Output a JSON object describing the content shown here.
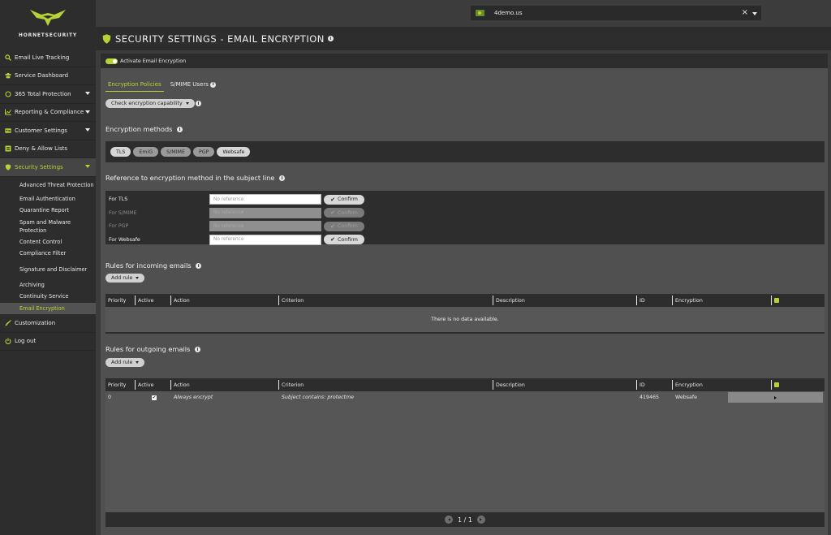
{
  "brand": {
    "name": "HORNETSECURITY",
    "accent": "#b4d337"
  },
  "tenant": {
    "name": "4demo.us"
  },
  "sidebar": {
    "items": [
      {
        "label": "Email Live Tracking",
        "icon": "search-icon"
      },
      {
        "label": "Service Dashboard",
        "icon": "users-icon"
      },
      {
        "label": "365 Total Protection",
        "icon": "circle-icon"
      },
      {
        "label": "Reporting & Compliance",
        "icon": "chart-icon"
      },
      {
        "label": "Customer Settings",
        "icon": "id-card-icon"
      },
      {
        "label": "Deny & Allow Lists",
        "icon": "list-icon"
      },
      {
        "label": "Security Settings",
        "icon": "shield-icon"
      }
    ],
    "security_sub": [
      "Advanced Threat Protection",
      "Email Authentication",
      "Quarantine Report",
      "Spam and Malware Protection",
      "Content Control",
      "Compliance Filter",
      "Signature and Disclaimer",
      "Archiving",
      "Continuity Service",
      "Email Encryption"
    ],
    "bottom": [
      {
        "label": "Customization",
        "icon": "brush-icon"
      },
      {
        "label": "Log out",
        "icon": "power-icon"
      }
    ]
  },
  "page": {
    "title": "SECURITY SETTINGS - EMAIL ENCRYPTION"
  },
  "activate_label": "Activate Email Encryption",
  "tabs": [
    "Encryption Policies",
    "S/MIME Users"
  ],
  "check_capability": "Check encryption capability",
  "methods": {
    "title": "Encryption methods",
    "chips": [
      "TLS",
      "EmiG",
      "S/MIME",
      "PGP",
      "Websafe"
    ]
  },
  "subject": {
    "title": "Reference to encryption method in the subject line",
    "placeholder": "No reference",
    "confirm": "Confirm",
    "rows": [
      "For TLS",
      "For S/MIME",
      "For PGP",
      "For Websafe"
    ]
  },
  "incoming": {
    "title": "Rules for incoming emails",
    "add_rule": "Add rule",
    "no_data": "There is no data available."
  },
  "outgoing": {
    "title": "Rules for outgoing emails",
    "add_rule": "Add rule",
    "row": {
      "priority": "0",
      "action": "Always encrypt",
      "criterion": "Subject contains: protectme",
      "id": "419465",
      "encryption": "Websafe"
    }
  },
  "columns": [
    "Priority",
    "Active",
    "Action",
    "Criterion",
    "Description",
    "ID",
    "Encryption"
  ],
  "pager": {
    "text": "1 / 1"
  }
}
